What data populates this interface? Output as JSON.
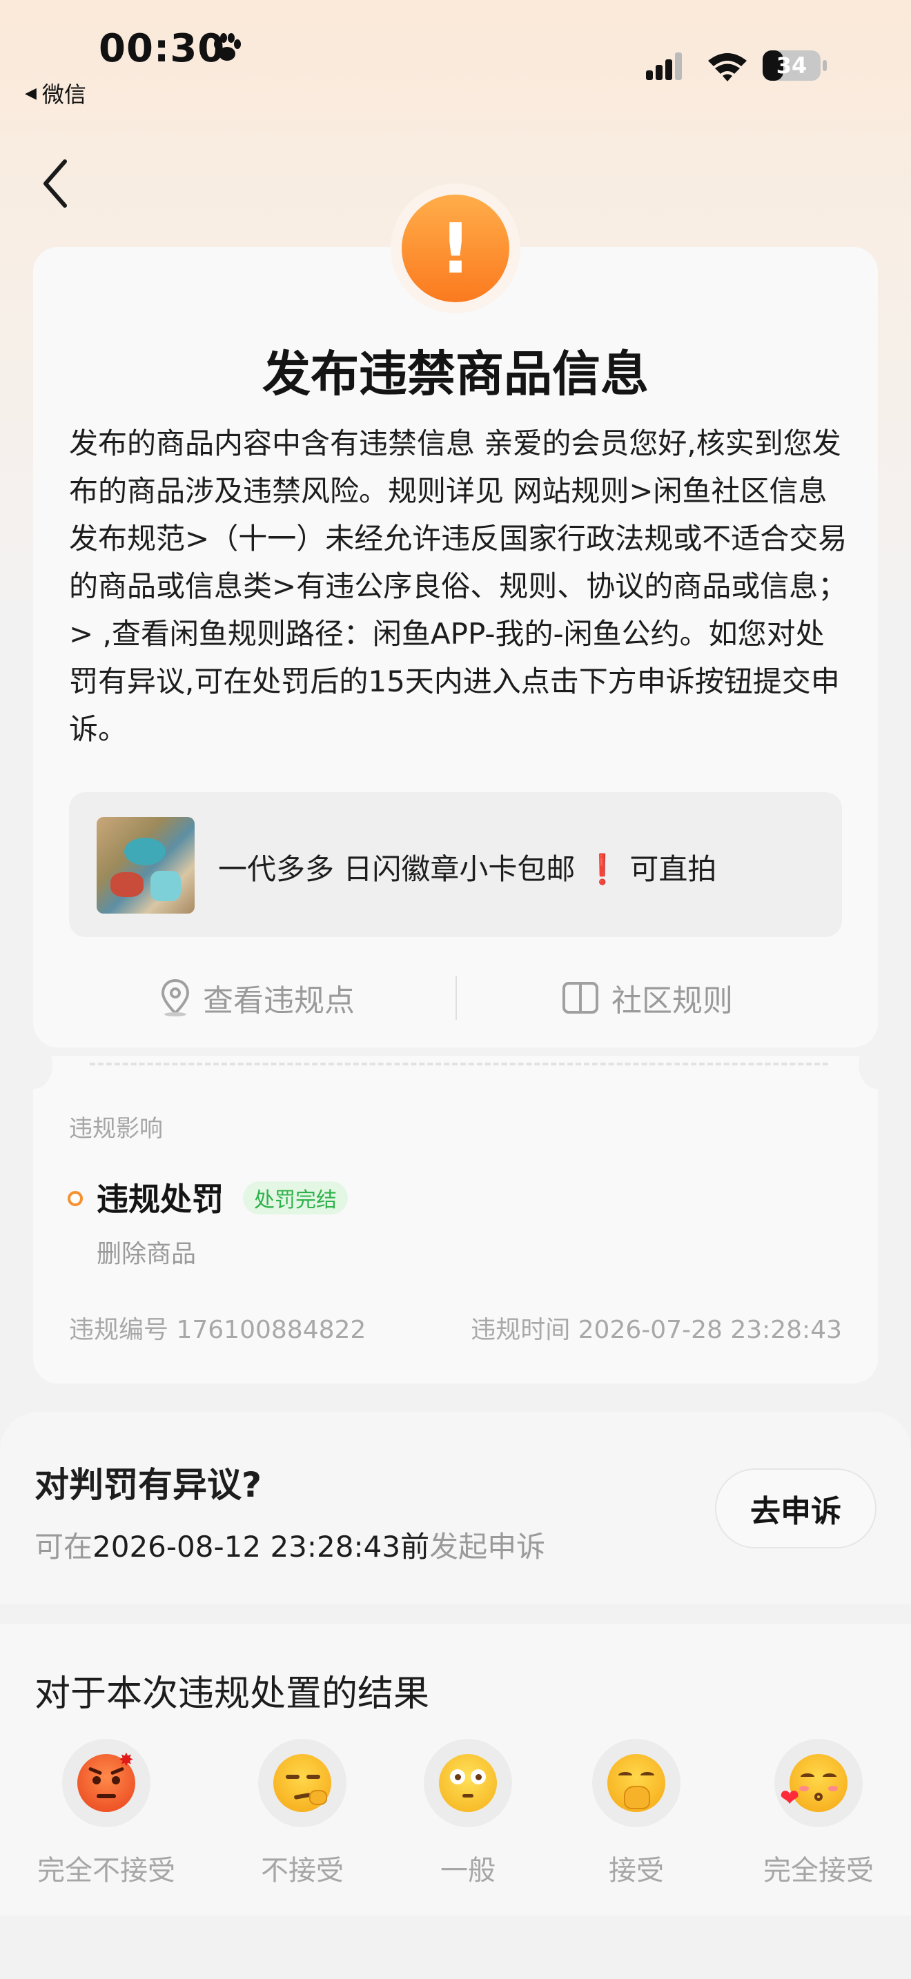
{
  "status_bar": {
    "time": "00:30",
    "back_app": "微信",
    "battery": "34"
  },
  "violation": {
    "title": "发布违禁商品信息",
    "description": "发布的商品内容中含有违禁信息 亲爱的会员您好,核实到您发布的商品涉及违禁风险。规则详见 网站规则>闲鱼社区信息发布规范>（十一）未经允许违反国家行政法规或不适合交易的商品或信息类>有违公序良俗、规则、协议的商品或信息；> ,查看闲鱼规则路径：闲鱼APP-我的-闲鱼公约。如您对处罚有异议,可在处罚后的15天内进入点击下方申诉按钮提交申诉。",
    "product_title": "一代多多 日闪徽章小卡包邮",
    "product_title_suffix": "可直拍",
    "action_view_points": "查看违规点",
    "action_rules": "社区规则",
    "impact_label": "违规影响",
    "impact_title": "违规处罚",
    "impact_badge": "处罚完结",
    "impact_result": "删除商品",
    "violation_id_label": "违规编号",
    "violation_id": "176100884822",
    "violation_time_label": "违规时间",
    "violation_time": "2026-07-28 23:28:43"
  },
  "appeal": {
    "title": "对判罚有异议?",
    "sub_prefix": "可在",
    "deadline": "2026-08-12 23:28:43前",
    "sub_suffix": "发起申诉",
    "button": "去申诉"
  },
  "result": {
    "title": "对于本次违规处置的结果",
    "options": [
      {
        "label": "完全不接受",
        "icon": "angry-face-icon"
      },
      {
        "label": "不接受",
        "icon": "unamused-face-icon"
      },
      {
        "label": "一般",
        "icon": "neutral-face-icon"
      },
      {
        "label": "接受",
        "icon": "hand-over-mouth-face-icon"
      },
      {
        "label": "完全接受",
        "icon": "kissing-face-icon"
      }
    ]
  },
  "colors": {
    "accent_orange": "#fb7a1f",
    "badge_green": "#2fb24b",
    "badge_green_bg": "#e4f7e5",
    "red_mark": "#e0182b"
  }
}
